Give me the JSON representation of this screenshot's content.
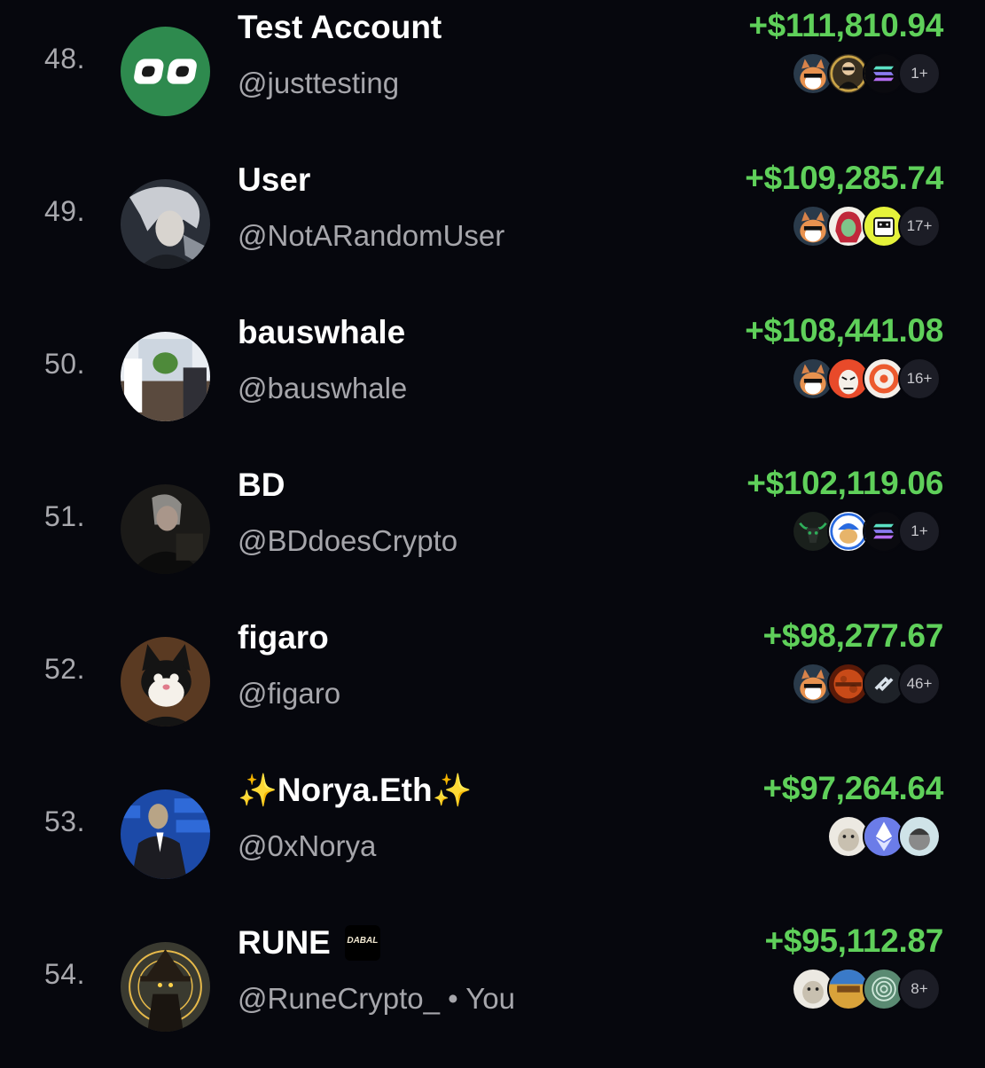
{
  "leaderboard": {
    "rows": [
      {
        "rank": "48.",
        "name": "Test Account",
        "handle": "@justtesting",
        "amount": "+$111,810.94",
        "tokens": [
          "cat-token-icon",
          "suit-man-token-icon",
          "solana-token-icon"
        ],
        "token_count": "1+"
      },
      {
        "rank": "49.",
        "name": "User",
        "handle": "@NotARandomUser",
        "amount": "+$109,285.74",
        "tokens": [
          "cat-token-icon",
          "red-hair-token-icon",
          "printer-token-icon"
        ],
        "token_count": "17+"
      },
      {
        "rank": "50.",
        "name": "bauswhale",
        "handle": "@bauswhale",
        "amount": "+$108,441.08",
        "tokens": [
          "cat-token-icon",
          "angry-face-token-icon",
          "orange-ring-token-icon"
        ],
        "token_count": "16+"
      },
      {
        "rank": "51.",
        "name": "BD",
        "handle": "@BDdoesCrypto",
        "amount": "+$102,119.06",
        "tokens": [
          "bull-skull-token-icon",
          "hardhat-cat-token-icon",
          "solana-token-icon"
        ],
        "token_count": "1+"
      },
      {
        "rank": "52.",
        "name": "figaro",
        "handle": "@figaro",
        "amount": "+$98,277.67",
        "tokens": [
          "cat-token-icon",
          "mars-token-icon",
          "swirl-token-icon"
        ],
        "token_count": "46+"
      },
      {
        "rank": "53.",
        "name": "Norya.Eth",
        "name_prefix": "✨",
        "name_suffix": "✨",
        "handle": "@0xNorya",
        "amount": "+$97,264.64",
        "tokens": [
          "white-cat-token-icon",
          "ethereum-token-icon",
          "helmet-cat-token-icon"
        ],
        "token_count": ""
      },
      {
        "rank": "54.",
        "name": "RUNE",
        "name_badge": "DABAL",
        "handle": "@RuneCrypto_ • You",
        "amount": "+$95,112.87",
        "tokens": [
          "white-cat-token-icon",
          "belle-token-icon",
          "green-rings-token-icon"
        ],
        "token_count": "8+"
      }
    ]
  },
  "colors": {
    "background": "#06070d",
    "amount_green": "#5fd05a",
    "muted_text": "#a6a6ab",
    "primary_text": "#ffffff"
  }
}
